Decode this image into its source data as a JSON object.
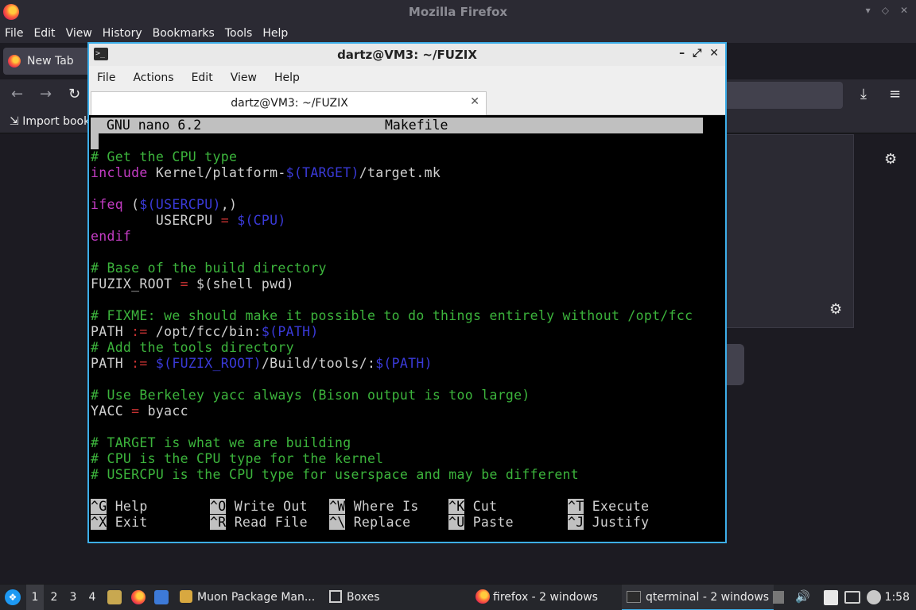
{
  "firefox": {
    "title": "Mozilla Firefox",
    "menu": [
      "File",
      "Edit",
      "View",
      "History",
      "Bookmarks",
      "Tools",
      "Help"
    ],
    "tab_label": "New Tab",
    "import_bookmarks": "Import book"
  },
  "terminal": {
    "title": "dartz@VM3: ~/FUZIX",
    "menu": [
      "File",
      "Actions",
      "Edit",
      "View",
      "Help"
    ],
    "tab_label": "dartz@VM3: ~/FUZIX",
    "nano_version": "GNU nano 6.2",
    "filename": "Makefile",
    "lines": {
      "l1": "# Get the CPU type",
      "l2a": "include",
      "l2b": " Kernel/platform-",
      "l2c": "$(TARGET)",
      "l2d": "/target.mk",
      "l3a": "ifeq",
      "l3b": " (",
      "l3c": "$(USERCPU)",
      "l3d": ",)",
      "l4a": "        USERCPU ",
      "l4b": "=",
      "l4c": " ",
      "l4d": "$(CPU)",
      "l5": "endif",
      "l6": "# Base of the build directory",
      "l7a": "FUZIX_ROOT ",
      "l7b": "=",
      "l7c": " $(shell pwd)",
      "l8": "# FIXME: we should make it possible to do things entirely without /opt/fcc",
      "l9a": "PATH ",
      "l9b": ":=",
      "l9c": " /opt/fcc/bin:",
      "l9d": "$(PATH)",
      "l10": "# Add the tools directory",
      "l11a": "PATH ",
      "l11b": ":=",
      "l11c": " ",
      "l11d": "$(FUZIX_ROOT)",
      "l11e": "/Build/tools/:",
      "l11f": "$(PATH)",
      "l12": "# Use Berkeley yacc always (Bison output is too large)",
      "l13a": "YACC ",
      "l13b": "=",
      "l13c": " byacc",
      "l14": "# TARGET is what we are building",
      "l15": "# CPU is the CPU type for the kernel",
      "l16": "# USERCPU is the CPU type for userspace and may be different"
    },
    "shortcuts": [
      {
        "key": "^G",
        "label": " Help"
      },
      {
        "key": "^O",
        "label": " Write Out"
      },
      {
        "key": "^W",
        "label": " Where Is"
      },
      {
        "key": "^K",
        "label": " Cut"
      },
      {
        "key": "^T",
        "label": " Execute"
      },
      {
        "key": "^X",
        "label": " Exit"
      },
      {
        "key": "^R",
        "label": " Read File"
      },
      {
        "key": "^\\",
        "label": " Replace"
      },
      {
        "key": "^U",
        "label": " Paste"
      },
      {
        "key": "^J",
        "label": " Justify"
      }
    ]
  },
  "taskbar": {
    "desktops": [
      "1",
      "2",
      "3",
      "4"
    ],
    "tasks": {
      "muon": "Muon Package Man...",
      "boxes": "Boxes",
      "firefox": "firefox - 2 windows",
      "qterminal": "qterminal - 2 windows"
    },
    "clock": "1:58"
  },
  "colors": {
    "accent": "#3daee9",
    "comment": "#3cb43c",
    "keyword": "#c43cc4",
    "variable": "#3a3ad8",
    "operator": "#c83232"
  }
}
